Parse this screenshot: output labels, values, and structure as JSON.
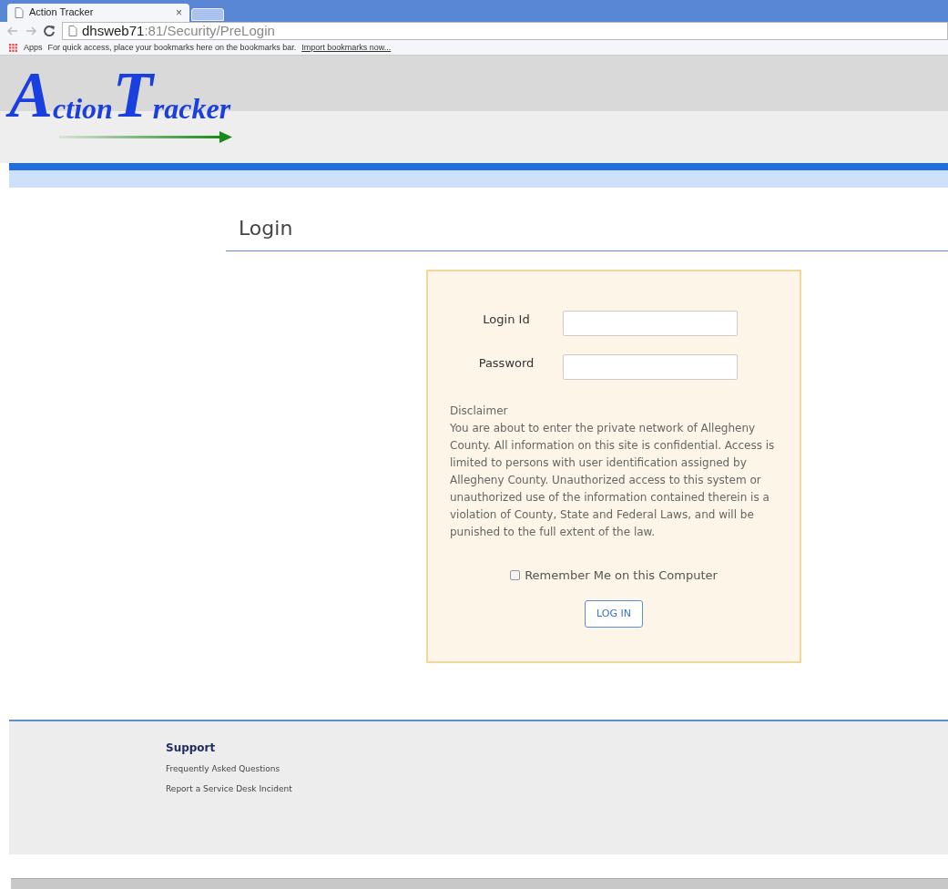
{
  "browser": {
    "tab": {
      "title": "Action Tracker",
      "close": "×"
    },
    "address": {
      "host": "dhsweb71",
      "rest": ":81/Security/PreLogin"
    },
    "bookmarks": {
      "apps": "Apps",
      "hint": "For quick access, place your bookmarks here on the bookmarks bar.",
      "import_link": "Import bookmarks now..."
    }
  },
  "logo": {
    "initial_1": "A",
    "rest_1": "ction",
    "initial_2": "T",
    "rest_2": "racker"
  },
  "page_title": "Login",
  "form": {
    "fields": [
      {
        "label": "Login Id"
      },
      {
        "label": "Password"
      }
    ],
    "disclaimer_title": "Disclaimer",
    "disclaimer": "You are about to enter the private network of Allegheny County. All information on this site is confidential. Access is limited to persons with user identification assigned by Allegheny County. Unauthorized access to this system or unauthorized use of the information contained therein is a violation of County, State and Federal Laws, and will be punished to the full extent of the law.",
    "remember": {
      "label": "Remember Me on this Computer",
      "checked": false
    },
    "submit": "LOG IN"
  },
  "footer": {
    "heading": "Support",
    "links": [
      "Frequently Asked Questions",
      "Report a Service Desk Incident"
    ]
  }
}
